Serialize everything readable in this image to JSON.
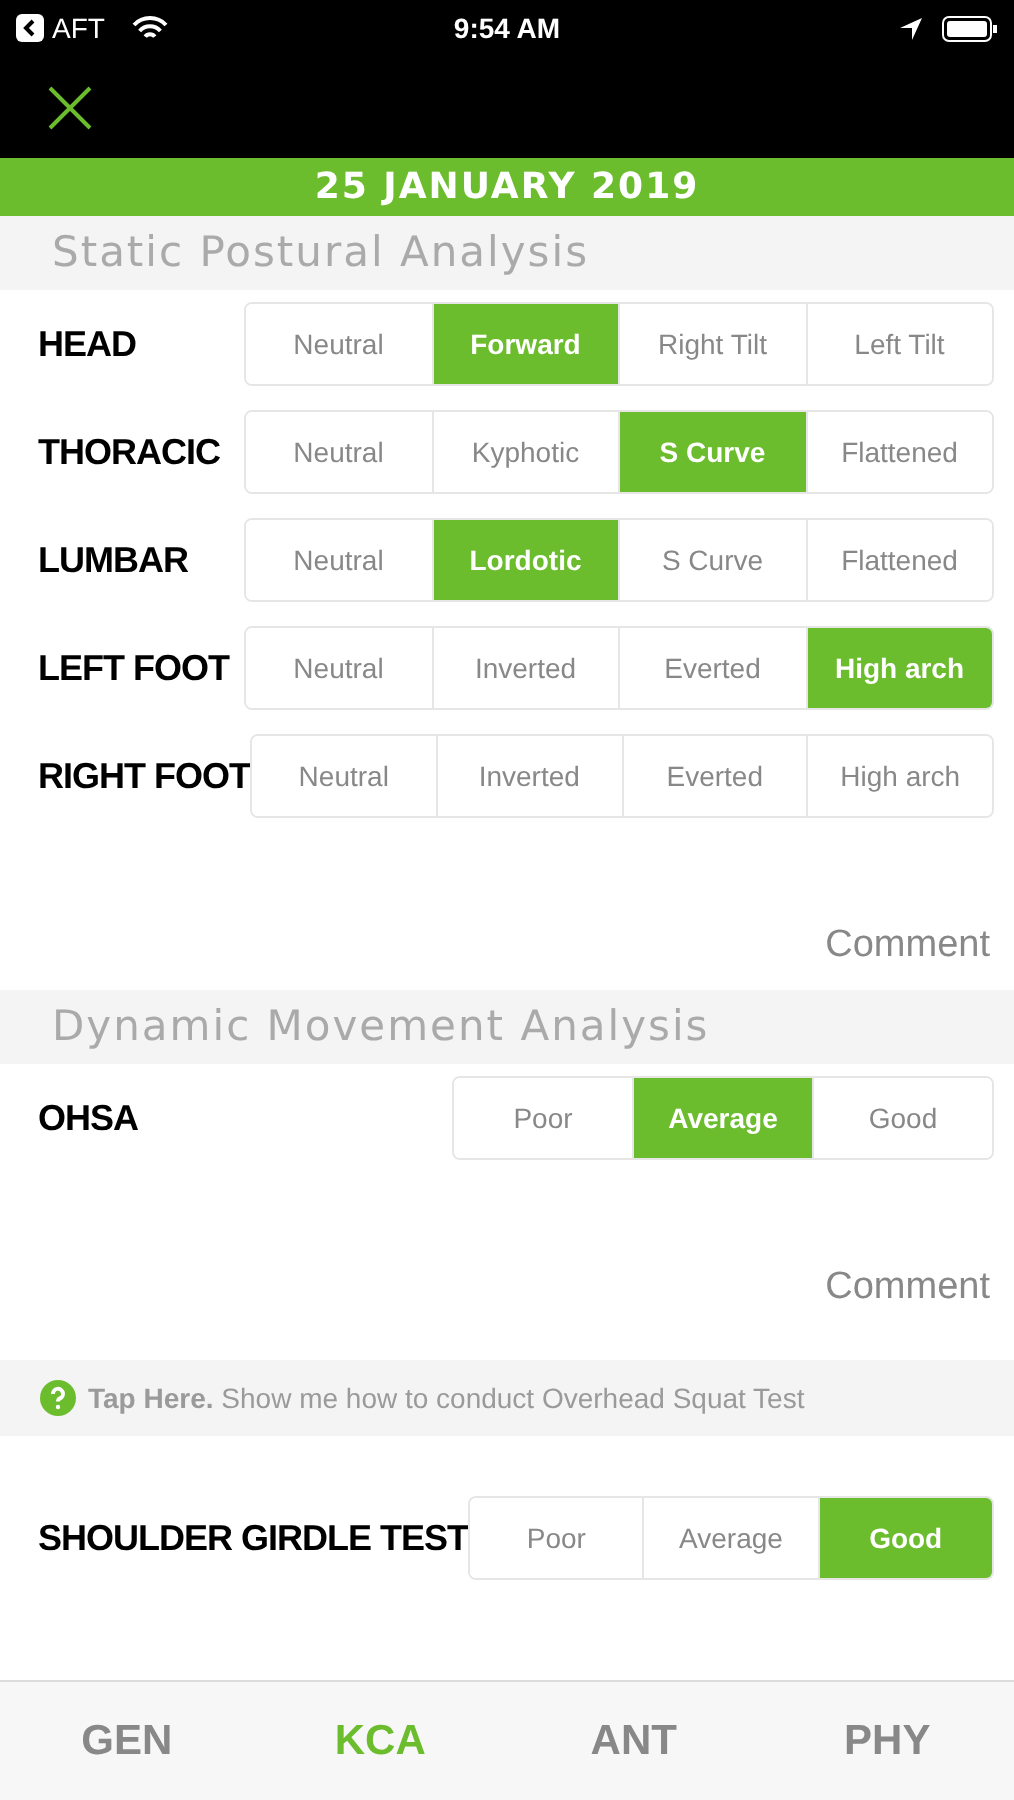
{
  "status_bar": {
    "back_label": "AFT",
    "time": "9:54 AM"
  },
  "date_banner": "25 JANUARY 2019",
  "sections": [
    {
      "title": "Static Postural Analysis",
      "items": [
        {
          "kind": "choice",
          "label": "HEAD",
          "options": [
            {
              "label": "Neutral",
              "selected": false
            },
            {
              "label": "Forward",
              "selected": true
            },
            {
              "label": "Right Tilt",
              "selected": false
            },
            {
              "label": "Left Tilt",
              "selected": false
            }
          ]
        },
        {
          "kind": "choice",
          "label": "THORACIC",
          "options": [
            {
              "label": "Neutral",
              "selected": false
            },
            {
              "label": "Kyphotic",
              "selected": false
            },
            {
              "label": "S Curve",
              "selected": true
            },
            {
              "label": "Flattened",
              "selected": false
            }
          ]
        },
        {
          "kind": "choice",
          "label": "LUMBAR",
          "options": [
            {
              "label": "Neutral",
              "selected": false
            },
            {
              "label": "Lordotic",
              "selected": true
            },
            {
              "label": "S Curve",
              "selected": false
            },
            {
              "label": "Flattened",
              "selected": false
            }
          ]
        },
        {
          "kind": "choice",
          "label": "LEFT FOOT",
          "options": [
            {
              "label": "Neutral",
              "selected": false
            },
            {
              "label": "Inverted",
              "selected": false
            },
            {
              "label": "Everted",
              "selected": false
            },
            {
              "label": "High arch",
              "selected": true
            }
          ]
        },
        {
          "kind": "choice",
          "label": "RIGHT FOOT",
          "options": [
            {
              "label": "Neutral",
              "selected": false
            },
            {
              "label": "Inverted",
              "selected": false
            },
            {
              "label": "Everted",
              "selected": false
            },
            {
              "label": "High arch",
              "selected": false
            }
          ]
        },
        {
          "kind": "comment",
          "placeholder": "Comment"
        }
      ]
    },
    {
      "title": "Dynamic Movement Analysis",
      "items": [
        {
          "kind": "choice",
          "label": "OHSA",
          "options": [
            {
              "label": "Poor",
              "selected": false
            },
            {
              "label": "Average",
              "selected": true
            },
            {
              "label": "Good",
              "selected": false
            }
          ]
        },
        {
          "kind": "comment",
          "placeholder": "Comment"
        },
        {
          "kind": "help",
          "lead": "Tap Here.",
          "text": "Show me how to conduct Overhead Squat Test"
        },
        {
          "kind": "choice",
          "label": "SHOULDER GIRDLE TEST",
          "options": [
            {
              "label": "Poor",
              "selected": false
            },
            {
              "label": "Average",
              "selected": false
            },
            {
              "label": "Good",
              "selected": true
            }
          ]
        }
      ]
    }
  ],
  "tabs": [
    {
      "label": "GEN",
      "selected": false
    },
    {
      "label": "KCA",
      "selected": true
    },
    {
      "label": "ANT",
      "selected": false
    },
    {
      "label": "PHY",
      "selected": false
    }
  ]
}
